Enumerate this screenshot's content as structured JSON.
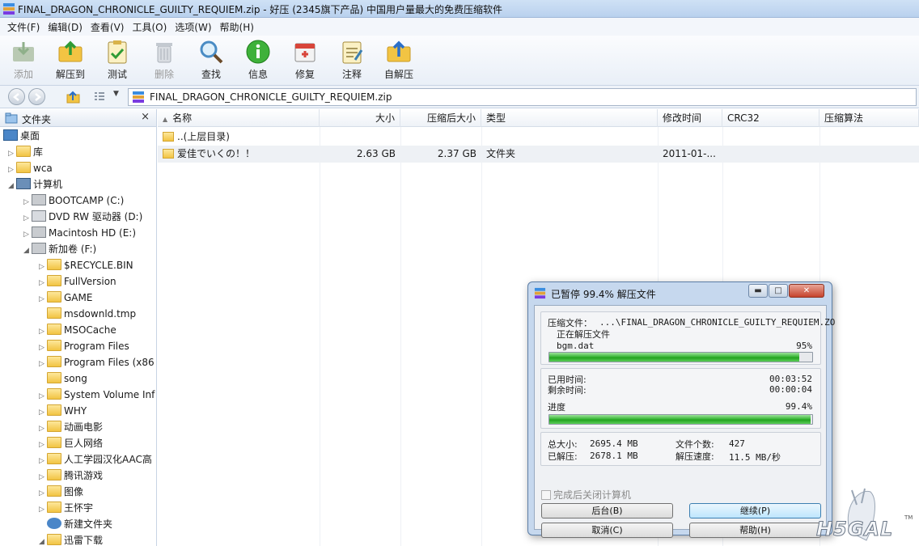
{
  "window": {
    "title": "FINAL_DRAGON_CHRONICLE_GUILTY_REQUIEM.zip - 好压 (2345旗下产品) 中国用户量最大的免费压缩软件"
  },
  "menu": [
    "文件(F)",
    "编辑(D)",
    "查看(V)",
    "工具(O)",
    "选项(W)",
    "帮助(H)"
  ],
  "toolbar": {
    "add": "添加",
    "extract_to": "解压到",
    "test": "测试",
    "delete": "删除",
    "find": "查找",
    "info": "信息",
    "repair": "修复",
    "comment": "注释",
    "self_extract": "自解压"
  },
  "address": {
    "path": "FINAL_DRAGON_CHRONICLE_GUILTY_REQUIEM.zip"
  },
  "folder_pane": {
    "header": "文件夹",
    "close": "×",
    "tree": [
      {
        "label": "桌面"
      },
      {
        "label": "库"
      },
      {
        "label": "wca"
      },
      {
        "label": "计算机"
      },
      {
        "label": "BOOTCAMP (C:)"
      },
      {
        "label": "DVD RW 驱动器 (D:)"
      },
      {
        "label": "Macintosh HD (E:)"
      },
      {
        "label": "新加卷 (F:)"
      },
      {
        "label": "$RECYCLE.BIN"
      },
      {
        "label": "FullVersion"
      },
      {
        "label": "GAME"
      },
      {
        "label": "msdownld.tmp"
      },
      {
        "label": "MSOCache"
      },
      {
        "label": "Program Files"
      },
      {
        "label": "Program Files (x86"
      },
      {
        "label": "song"
      },
      {
        "label": "System Volume Inf"
      },
      {
        "label": "WHY"
      },
      {
        "label": "动画电影"
      },
      {
        "label": "巨人网络"
      },
      {
        "label": "人工学园汉化AAC高"
      },
      {
        "label": "腾讯游戏"
      },
      {
        "label": "图像"
      },
      {
        "label": "王怀宇"
      },
      {
        "label": "新建文件夹"
      },
      {
        "label": "迅雷下载"
      }
    ]
  },
  "file_list": {
    "columns": {
      "name": "名称",
      "size": "大小",
      "packed": "压缩后大小",
      "type": "类型",
      "modified": "修改时间",
      "crc": "CRC32",
      "method": "压缩算法"
    },
    "rows": [
      {
        "name": "..(上层目录)",
        "size": "",
        "packed": "",
        "type": "",
        "modified": ""
      },
      {
        "name": "爱佳でいくの！！",
        "size": "2.63 GB",
        "packed": "2.37 GB",
        "type": "文件夹",
        "modified": "2011-01-..."
      }
    ]
  },
  "dialog": {
    "title": "已暂停 99.4% 解压文件",
    "archive_label": "压缩文件：",
    "archive_path": "...\\FINAL_DRAGON_CHRONICLE_GUILTY_REQUIEM.ZO",
    "status": "正在解压文件",
    "current_file": "bgm.dat",
    "file_percent": "95%",
    "file_progress": 0.95,
    "elapsed_label": "已用时间:",
    "elapsed": "00:03:52",
    "remaining_label": "剩余时间:",
    "remaining": "00:00:04",
    "progress_label": "进度",
    "progress_percent": "99.4%",
    "progress": 0.994,
    "total_size_label": "总大小:",
    "total_size": "2695.4 MB",
    "extracted_label": "已解压:",
    "extracted": "2678.1 MB",
    "file_count_label": "文件个数:",
    "file_count": "427",
    "speed_label": "解压速度:",
    "speed": "11.5 MB/秒",
    "shutdown_label": "完成后关闭计算机",
    "buttons": {
      "background": "后台(B)",
      "continue": "继续(P)",
      "cancel": "取消(C)",
      "help": "帮助(H)"
    }
  },
  "watermark": {
    "text": "H5GAL",
    "tm": "TM"
  }
}
